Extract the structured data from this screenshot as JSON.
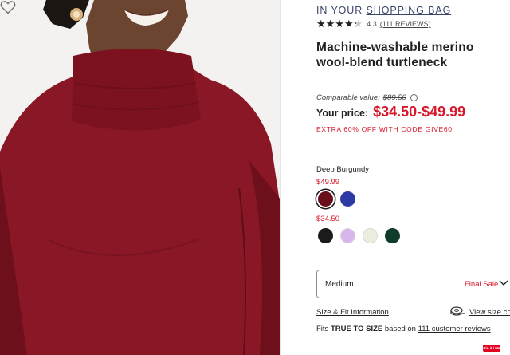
{
  "bag": {
    "prefix": "IN YOUR ",
    "link": "SHOPPING BAG"
  },
  "rating": {
    "stars_display": "★★★★★",
    "score": 4.3,
    "value_text": "4.3",
    "reviews_text": "(111 REVIEWS)"
  },
  "product": {
    "title": "Machine-washable merino wool-blend turtleneck"
  },
  "pricing": {
    "comparable_label": "Comparable value:",
    "comparable_value": "$89.50",
    "info_glyph": "i",
    "your_price_label": "Your price:",
    "price_range": "$34.50-$49.99",
    "promo": "EXTRA 60% OFF WITH CODE GIVE60"
  },
  "colors": {
    "selected_name": "Deep Burgundy",
    "groups": [
      {
        "price": "$49.99",
        "swatches": [
          {
            "name": "deep-burgundy",
            "hex": "#6a0f1c",
            "selected": true
          },
          {
            "name": "royal-blue",
            "hex": "#2e3aa3",
            "selected": false
          }
        ]
      },
      {
        "price": "$34.50",
        "swatches": [
          {
            "name": "black",
            "hex": "#1b1b1b",
            "selected": false
          },
          {
            "name": "lavender",
            "hex": "#d8b6ec",
            "selected": false
          },
          {
            "name": "ivory",
            "hex": "#ececdf",
            "selected": false
          },
          {
            "name": "forest-green",
            "hex": "#0f3b2a",
            "selected": false
          }
        ]
      }
    ]
  },
  "size": {
    "value": "Medium",
    "note": "Final Sale",
    "icon": "chevron-down-icon"
  },
  "fit": {
    "size_fit_link": "Size & Fit Information",
    "view_size_chart": "View size chart",
    "note_prefix": "Fits ",
    "note_bold": "TRUE TO SIZE",
    "note_mid": " based on ",
    "note_link": "111 customer reviews"
  },
  "pinit": {
    "label": "Pin it / Me"
  },
  "icons": {
    "wishlist": "heart-icon",
    "info": "info-icon",
    "measure": "measuring-tape-icon"
  },
  "theme": {
    "accent_red": "#d6182a",
    "navy": "#39466a",
    "sweater": "#8a1725"
  }
}
